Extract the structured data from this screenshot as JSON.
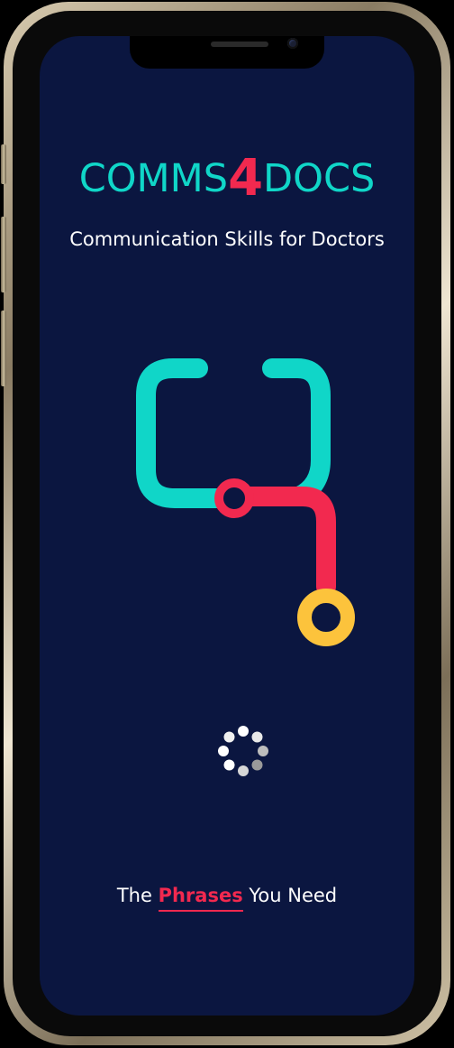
{
  "brand": {
    "prefix": "COMMS",
    "number": "4",
    "suffix": "DOCS"
  },
  "tagline": "Communication Skills for Doctors",
  "footer": {
    "before": "The",
    "highlight": "Phrases",
    "after": "You Need"
  },
  "icons": {
    "logo": "stethoscope-icon",
    "spinner": "loading-spinner-icon"
  },
  "colors": {
    "background": "#0b1640",
    "teal": "#10d6c8",
    "red": "#f2294f",
    "yellow": "#fcc33c",
    "text": "#ffffff"
  }
}
